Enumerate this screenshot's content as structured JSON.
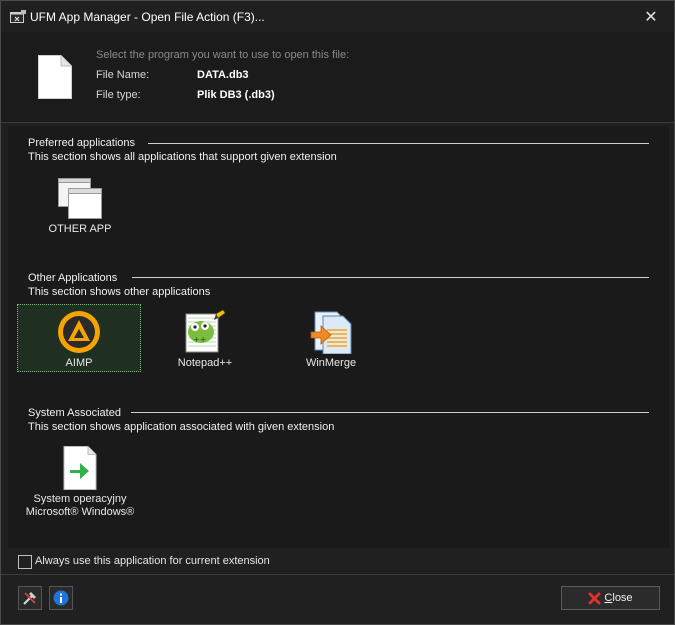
{
  "window": {
    "title": "UFM App Manager - Open File Action (F3)..."
  },
  "header": {
    "prompt": "Select the program you want to use to open this file:",
    "file_name_label": "File Name:",
    "file_name_value": "DATA.db3",
    "file_type_label": "File type:",
    "file_type_value": "Plik DB3 (.db3)"
  },
  "sections": {
    "preferred": {
      "title": "Preferred applications",
      "description": "This section shows all applications that support given extension",
      "apps": [
        {
          "label": "OTHER APP",
          "icon": "windows-app-icon"
        }
      ]
    },
    "other": {
      "title": "Other Applications",
      "description": "This section shows other applications",
      "apps": [
        {
          "label": "AIMP",
          "icon": "aimp-icon",
          "selected": true
        },
        {
          "label": "Notepad++",
          "icon": "notepadpp-icon"
        },
        {
          "label": "WinMerge",
          "icon": "winmerge-icon"
        }
      ]
    },
    "system": {
      "title": "System Associated",
      "description": "This section shows application associated with given extension",
      "apps": [
        {
          "label_line1": "System operacyjny",
          "label_line2": "Microsoft® Windows®",
          "icon": "shell-open-icon"
        }
      ]
    }
  },
  "footer": {
    "always_use_label": "Always use this application for current extension",
    "always_use_checked": false,
    "close_label_accel": "C",
    "close_label_rest": "lose"
  },
  "colors": {
    "background": "#202020",
    "content_background": "#1a1a1a",
    "selected_background": "#1f3022",
    "selected_border": "#7ab37a",
    "close_red": "#e03030",
    "info_blue": "#1e74d8"
  }
}
